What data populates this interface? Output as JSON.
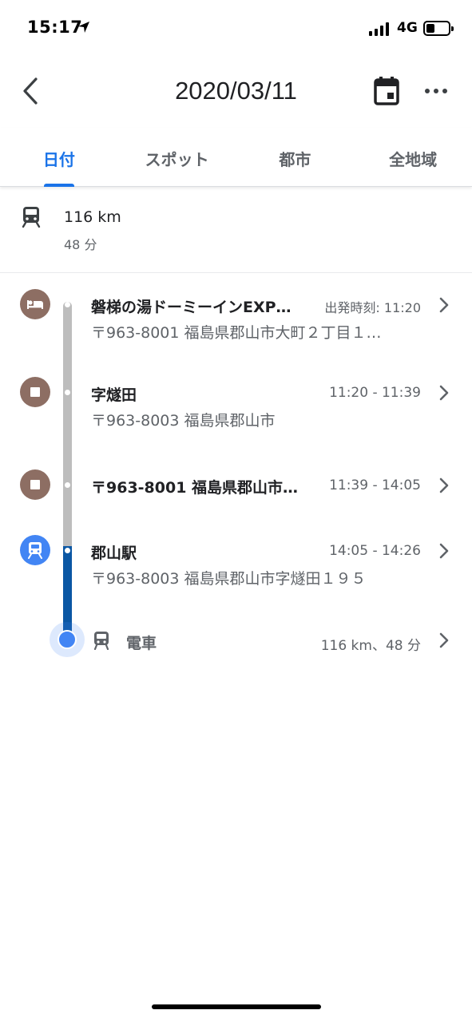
{
  "status_bar": {
    "time": "15:17",
    "network": "4G"
  },
  "header": {
    "title": "2020/03/11"
  },
  "tabs": [
    {
      "label": "日付",
      "active": true
    },
    {
      "label": "スポット",
      "active": false
    },
    {
      "label": "都市",
      "active": false
    },
    {
      "label": "全地域",
      "active": false
    }
  ],
  "summary": {
    "distance": "116 km",
    "duration": "48 分",
    "icon": "train-icon"
  },
  "stops": [
    {
      "name": "磐梯の湯ドーミーインEXP…",
      "time": "出発時刻: 11:20",
      "address": "〒963-8001 福島県郡山市大町２丁目１…",
      "icon": "hotel-bed-icon"
    },
    {
      "name": "字燧田",
      "time": "11:20 - 11:39",
      "address": "〒963-8003 福島県郡山市",
      "icon": "stop-square-icon"
    },
    {
      "name": "〒963-8001 福島県郡山市…",
      "time": "11:39 - 14:05",
      "address": "",
      "icon": "stop-square-icon"
    },
    {
      "name": "郡山駅",
      "time": "14:05 - 14:26",
      "address": "〒963-8003 福島県郡山市字燧田１９５",
      "icon": "train-station-icon"
    }
  ],
  "transit": {
    "label": "電車",
    "detail": "116 km、48 分",
    "icon": "train-icon"
  },
  "colors": {
    "accent": "#1a73e8",
    "place_icon": "#8d6e63",
    "station_icon": "#4285f4",
    "line_past": "#bdbdbd",
    "line_current": "#0b57a4"
  }
}
